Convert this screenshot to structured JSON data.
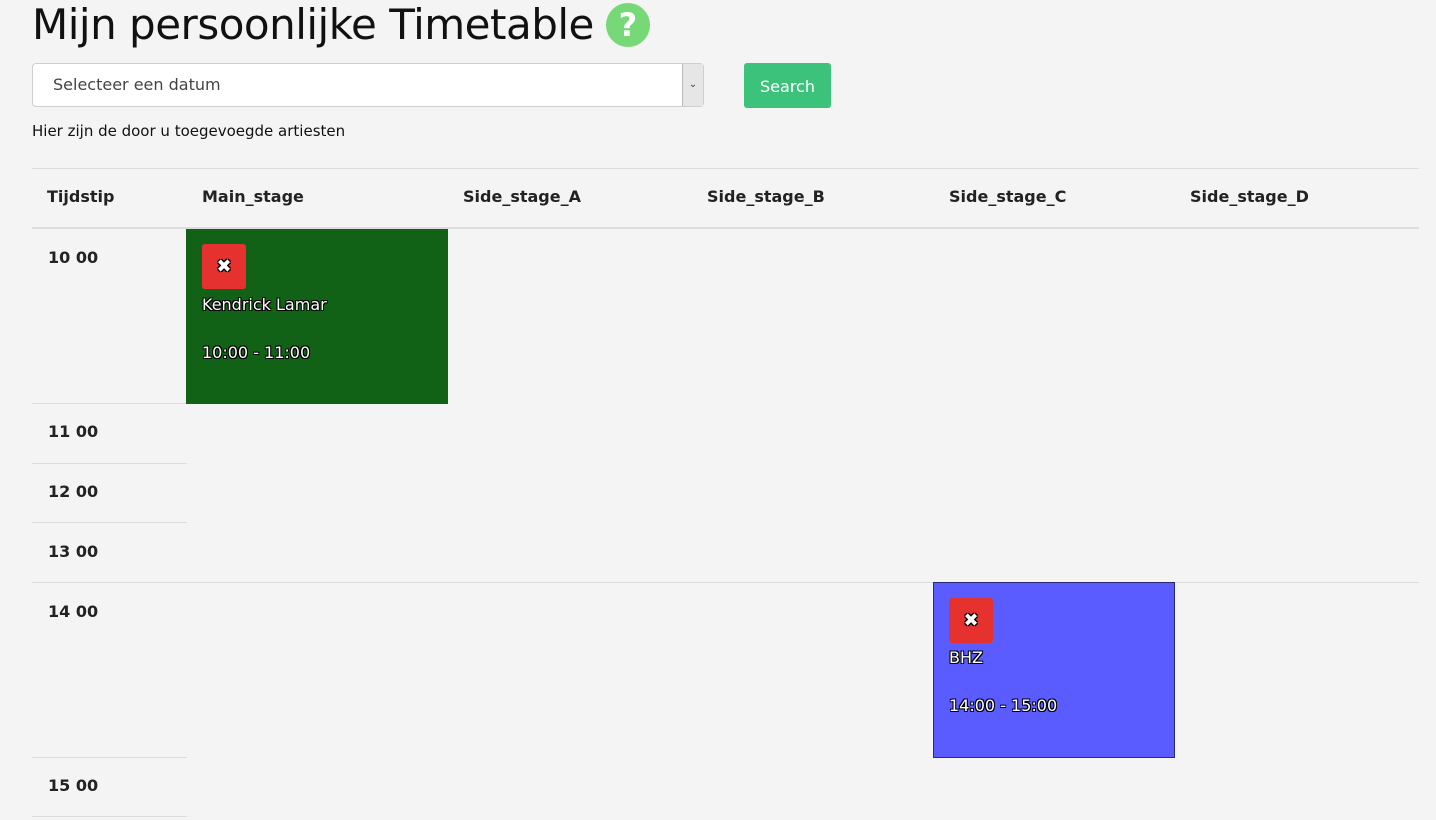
{
  "header": {
    "title": "Mijn persoonlijke Timetable",
    "help_icon": "question-circle-icon",
    "help_symbol": "?"
  },
  "date_select": {
    "value": "Selecteer een datum",
    "arrow": "⌄"
  },
  "search_button": {
    "label": "Search"
  },
  "intro_text": "Hier zijn de door u toegevoegde artiesten",
  "table": {
    "headers": [
      "Tijdstip",
      "Main_stage",
      "Side_stage_A",
      "Side_stage_B",
      "Side_stage_C",
      "Side_stage_D"
    ],
    "times": [
      "10 00",
      "11 00",
      "12 00",
      "13 00",
      "14 00",
      "15 00"
    ]
  },
  "events": [
    {
      "artist": "Kendrick Lamar",
      "time": "10:00 - 11:00",
      "stage": "Main_stage",
      "color": "#116116",
      "remove_symbol": "✖"
    },
    {
      "artist": "BHZ",
      "time": "14:00 - 15:00",
      "stage": "Side_stage_C",
      "color": "#5a5cff",
      "remove_symbol": "✖"
    }
  ],
  "colors": {
    "accent_green": "#3cc27a",
    "help_green": "#77d877",
    "remove_red": "#e6322f"
  }
}
